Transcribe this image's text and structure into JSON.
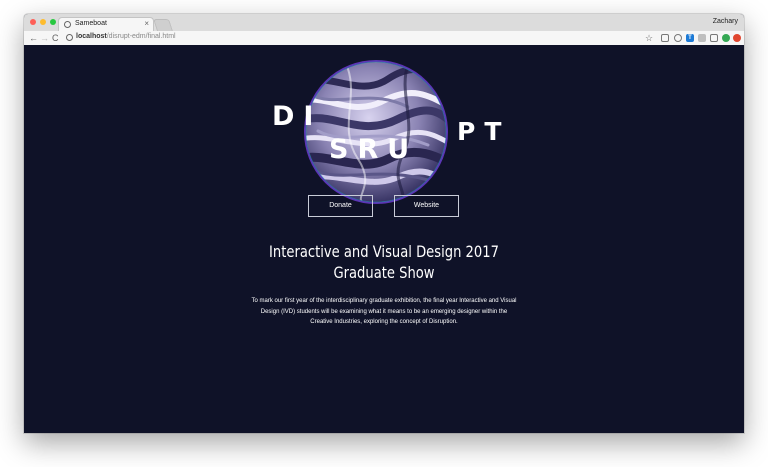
{
  "browser": {
    "tab_title": "Sameboat",
    "tab_close": "×",
    "profile_name": "Zachary",
    "url_host": "localhost",
    "url_path": "/disrupt-edm/final.html",
    "nav_back": "←",
    "nav_forward": "→",
    "nav_reload": "C",
    "bookmark_star": "☆",
    "ext_trello": "T"
  },
  "page": {
    "logo_part1": "DI",
    "logo_part2": "SRU",
    "logo_part3": "PT",
    "donate_label": "Donate",
    "website_label": "Website",
    "headline": "Interactive and Visual Design 2017 Graduate Show",
    "description": "To mark our first year of the interdisciplinary graduate exhibition, the final year Interactive and Visual Design (IVD) students will be examining what it means to be an emerging designer within the Creative Industries, exploring the concept of Disruption."
  },
  "colors": {
    "background": "#0f1228",
    "text": "#ffffff",
    "button_border": "#c9ccd8",
    "planet_light": "#d8d3ef",
    "planet_mid": "#8a83b3",
    "planet_dark": "#3b3767",
    "planet_edge": "#6f3fd8"
  },
  "icons": {
    "planet": "marbled-planet-graphic",
    "info": "info-icon",
    "extensions": [
      "cast-icon",
      "history-icon",
      "trello-icon",
      "extension-icon",
      "camera-icon",
      "extension-green-icon",
      "extension-red-icon"
    ]
  }
}
